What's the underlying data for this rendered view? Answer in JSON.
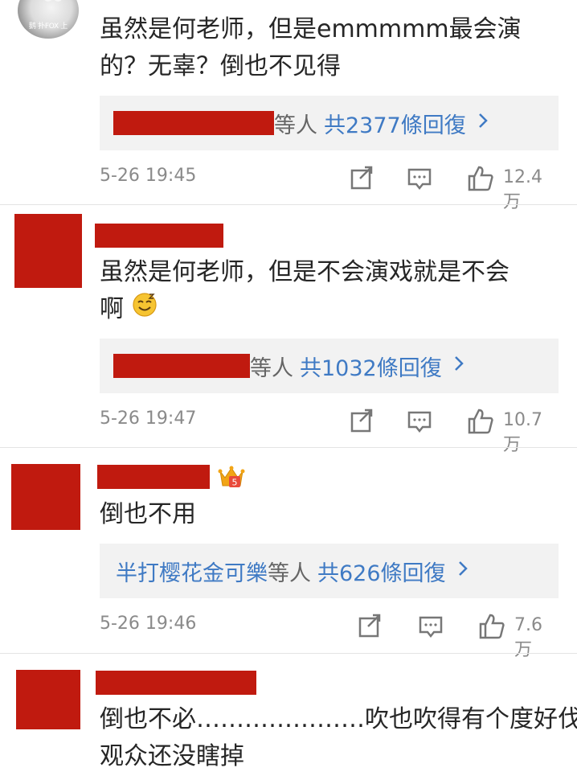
{
  "comments": [
    {
      "text_line1": "虽然是何老师，但是emmmmm最会演",
      "text_line2": "的？无辜？倒也不见得",
      "reply_who": "",
      "reply_deng": "等人",
      "reply_total": "共2377條回復",
      "time": "5-26 19:45",
      "likes": "12.4万",
      "avatar_watermark": "鹅 扑FOX 上"
    },
    {
      "text_line1": "虽然是何老师，但是不会演戏就是不会",
      "text_line2": "啊",
      "reply_who": "",
      "reply_deng": "等人",
      "reply_total": "共1032條回復",
      "time": "5-26 19:47",
      "likes": "10.7万"
    },
    {
      "text_line1": "倒也不用",
      "reply_who": "半打樱花金可樂",
      "reply_deng": "等人",
      "reply_total": "共626條回復",
      "time": "5-26 19:46",
      "likes": "7.6万",
      "badge_text": "5"
    },
    {
      "text_line1": "倒也不必…………………吹也吹得有个度好伐",
      "text_line2": "观众还没瞎掉"
    }
  ],
  "icons": {
    "share": "share-icon",
    "comment": "comment-icon",
    "like": "thumbs-up-icon",
    "chevron": "chevron-right-icon",
    "crown": "crown-badge-icon",
    "emoji": "sleepy-smile-emoji"
  },
  "colors": {
    "link": "#3f7ac4",
    "redaction": "#c01a0f",
    "meta": "#8a8a8a"
  }
}
